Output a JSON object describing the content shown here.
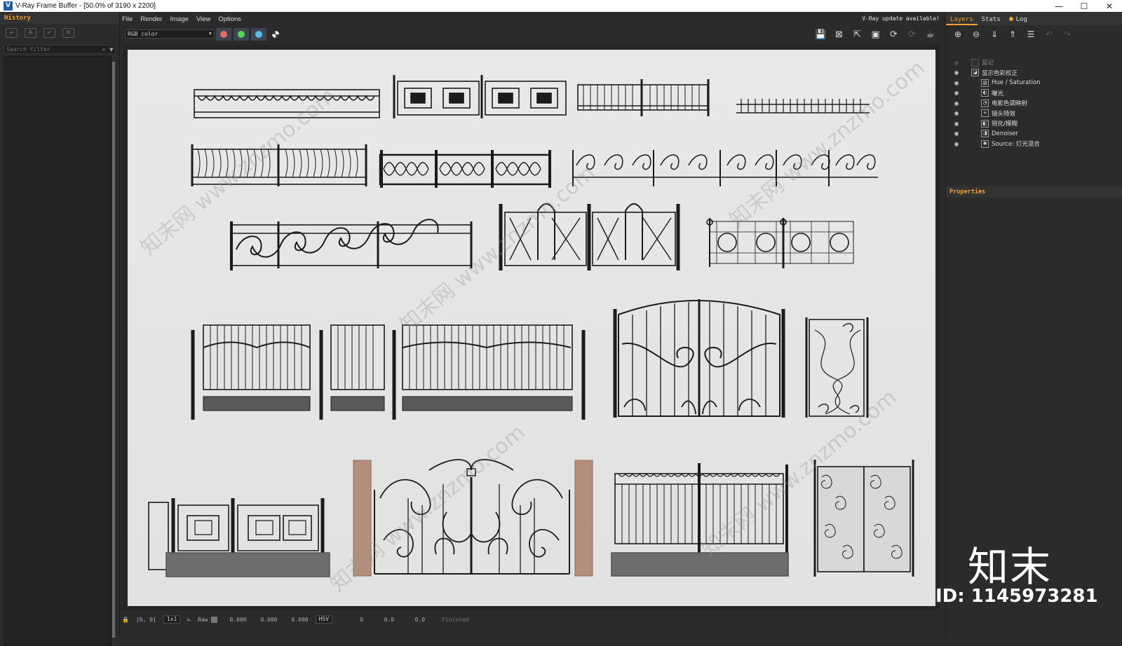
{
  "window": {
    "title": "V-Ray Frame Buffer - [50.0% of 3190 x 2200]",
    "icon_text": "V",
    "minimize": "—",
    "maximize": "☐",
    "close": "✕"
  },
  "history": {
    "header": "History",
    "search_placeholder": "Search filter",
    "search_icon": "search-icon"
  },
  "menu": {
    "items": [
      "File",
      "Render",
      "Image",
      "View",
      "Options"
    ]
  },
  "update_notice": "V-Ray update available!",
  "toolbar": {
    "channel": "RGB color",
    "channel_colors": {
      "red": "#ea6a6a",
      "green": "#5cd15c",
      "blue": "#5ab8ee"
    }
  },
  "status": {
    "coords": "[0, 0]",
    "zoom": "1x1",
    "raw_label": "Raw",
    "raw_values": [
      "0.000",
      "0.000",
      "0.000"
    ],
    "color_mode": "HSV",
    "hsv_values": [
      "0",
      "0.0",
      "0.0"
    ],
    "state": "Finished"
  },
  "right_tabs": {
    "layers": "Layers",
    "stats": "Stats",
    "log": "Log"
  },
  "layers": [
    {
      "name": "蓝记",
      "muted": true,
      "indent": 1
    },
    {
      "name": "显示色彩校正",
      "muted": false,
      "indent": 1
    },
    {
      "name": "Hue / Saturation",
      "muted": false,
      "indent": 2
    },
    {
      "name": "曝光",
      "muted": false,
      "indent": 2
    },
    {
      "name": "电影色调映射",
      "muted": false,
      "indent": 2
    },
    {
      "name": "镜头特效",
      "muted": false,
      "indent": 2
    },
    {
      "name": "锐化/模糊",
      "muted": false,
      "indent": 2
    },
    {
      "name": "Denoiser",
      "muted": false,
      "indent": 2
    },
    {
      "name": "Source: 灯光混合",
      "muted": false,
      "indent": 2
    }
  ],
  "properties": {
    "header": "Properties"
  },
  "watermark": {
    "text": "知末网 www.znzmo.com",
    "logo": "知末",
    "id": "ID: 1145973281"
  }
}
